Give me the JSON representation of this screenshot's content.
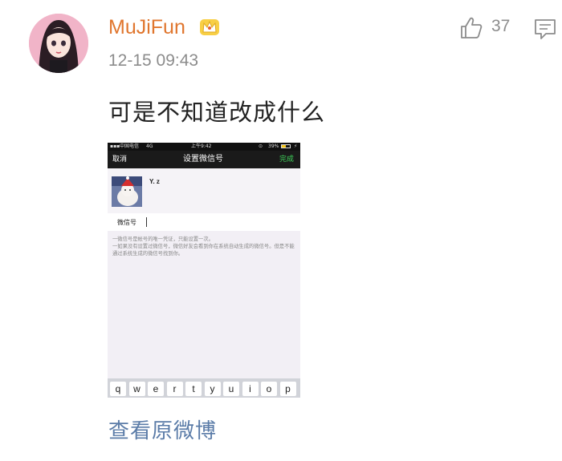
{
  "post": {
    "username": "MuJiFun",
    "timestamp": "12-15 09:43",
    "like_count": "37",
    "text": "可是不知道改成什么",
    "view_original": "查看原微博"
  },
  "icons": [
    "avatar",
    "crown-icon",
    "thumbs-up-icon",
    "comment-icon"
  ],
  "screenshot": {
    "status": {
      "carrier": "中国电信",
      "network": "4G",
      "time": "上午9:42",
      "battery": "39%"
    },
    "nav": {
      "cancel": "取消",
      "title": "设置微信号",
      "done": "完成"
    },
    "profile_name": "Y. z",
    "wechat_label": "微信号",
    "hint": "一微信号是帐号的唯一凭证，只能设置一次。\n一如果没有设置过微信号，微信好友会看到你在系统自动生成的微信号。但是不能通过系统生成的微信号找到你。",
    "keys": [
      "q",
      "w",
      "e",
      "r",
      "t",
      "y",
      "u",
      "i",
      "o",
      "p"
    ]
  },
  "colors": {
    "username": "#e0762e",
    "link": "#5b7ca8",
    "done": "#3fd15a",
    "meta": "#8c8c8c"
  }
}
